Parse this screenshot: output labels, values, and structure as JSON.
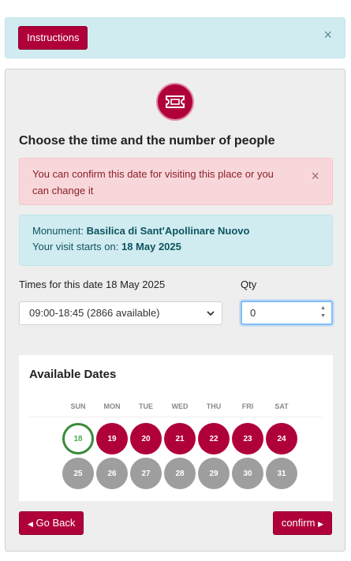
{
  "banner": {
    "instructions_label": "Instructions",
    "close_glyph": "×"
  },
  "page": {
    "heading": "Choose the time and the number of people"
  },
  "alert_danger": {
    "text": "You can confirm this date for visiting this place or you can change it",
    "close_glyph": "×"
  },
  "alert_info": {
    "monument_label": "Monument:",
    "monument_value": "Basilica di Sant'Apollinare Nuovo",
    "start_label": "Your visit starts on:",
    "start_value": "18 May 2025"
  },
  "times": {
    "label": "Times for this date 18 May 2025",
    "selected": "09:00-18:45 (2866 available)"
  },
  "qty": {
    "label": "Qty",
    "value": "0"
  },
  "dates": {
    "title": "Available Dates",
    "weekdays": [
      "SUN",
      "MON",
      "TUE",
      "WED",
      "THU",
      "FRI",
      "SAT"
    ],
    "week1": [
      "18",
      "19",
      "20",
      "21",
      "22",
      "23",
      "24"
    ],
    "week2": [
      "25",
      "26",
      "27",
      "28",
      "29",
      "30",
      "31"
    ]
  },
  "footer": {
    "back_label": "Go Back",
    "confirm_label": "confirm"
  },
  "colors": {
    "accent": "#b0003a",
    "unavailable": "#9e9e9e",
    "today_ring": "#3a8a3a"
  },
  "icons": {
    "ticket": "ticket-icon",
    "back": "caret-left-icon",
    "confirm": "caret-right-icon"
  }
}
